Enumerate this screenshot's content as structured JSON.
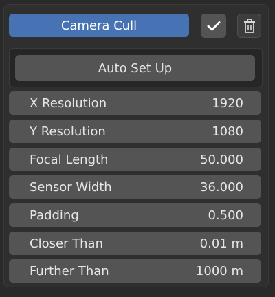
{
  "header": {
    "title": "Camera Cull",
    "confirm_icon": "checkmark-icon",
    "delete_icon": "trash-icon"
  },
  "auto_setup": {
    "label": "Auto Set Up"
  },
  "fields": [
    {
      "label": "X Resolution",
      "value": "1920"
    },
    {
      "label": "Y Resolution",
      "value": "1080"
    },
    {
      "label": "Focal Length",
      "value": "50.000"
    },
    {
      "label": "Sensor Width",
      "value": "36.000"
    },
    {
      "label": "Padding",
      "value": "0.500"
    },
    {
      "label": "Closer Than",
      "value": "0.01 m"
    },
    {
      "label": "Further Than",
      "value": "1000 m"
    }
  ],
  "colors": {
    "accent": "#4772b3",
    "field_bg": "#545454",
    "panel_bg": "#2f2f2f",
    "text": "#e6e6e6"
  }
}
